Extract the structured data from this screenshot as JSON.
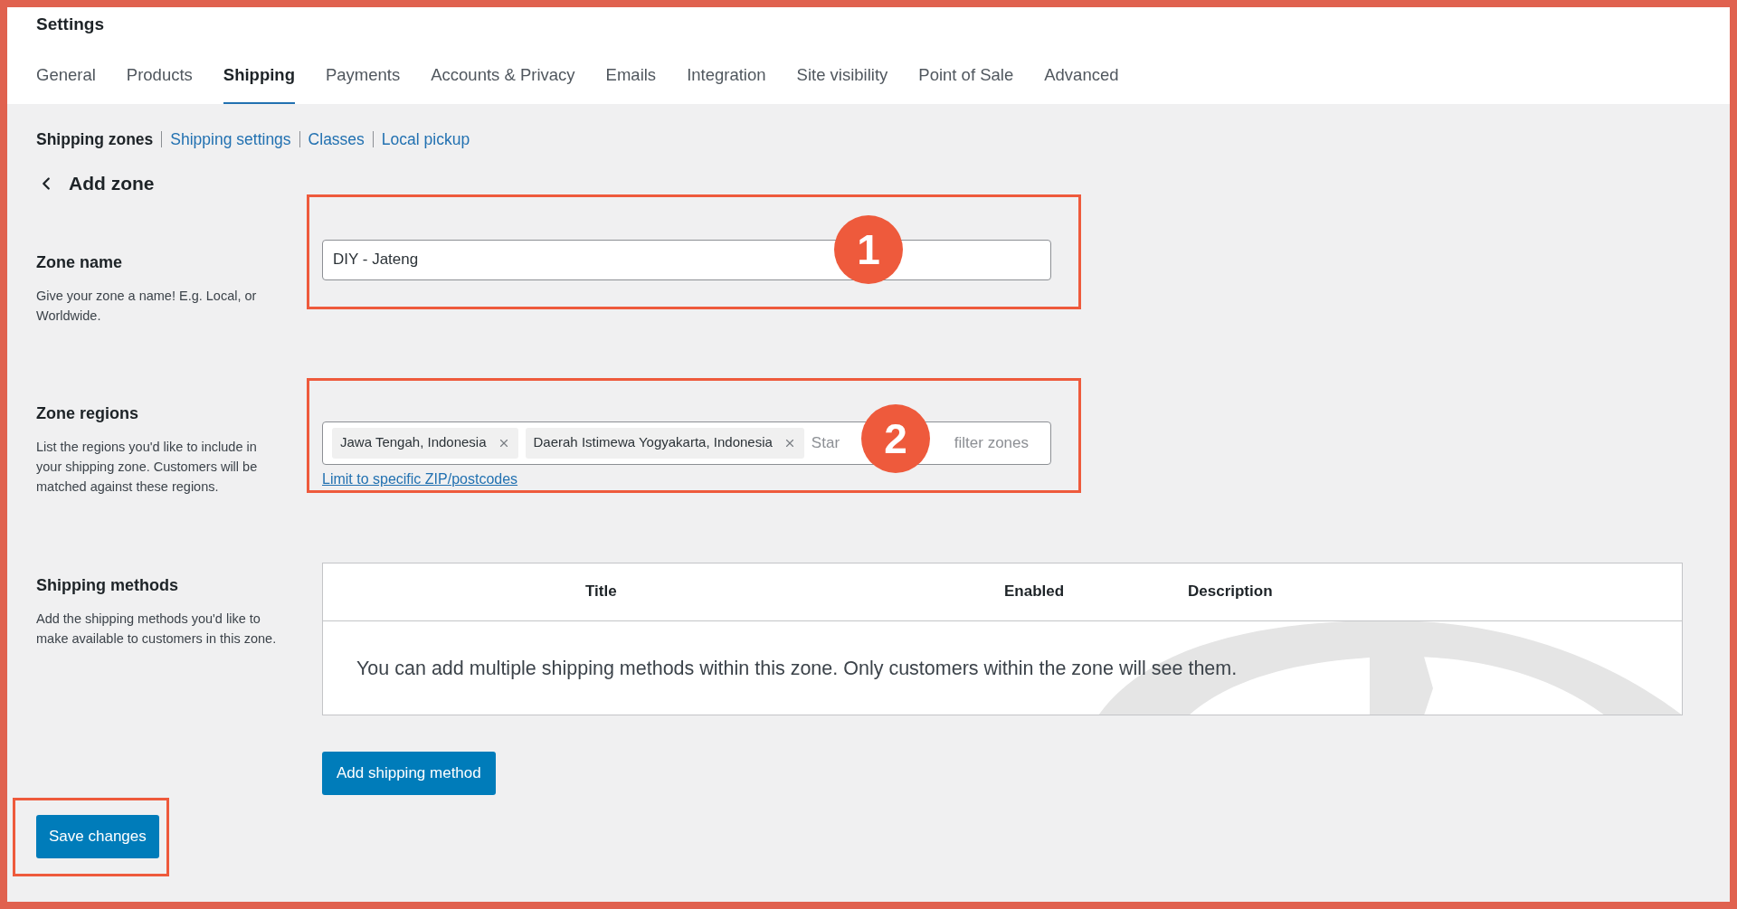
{
  "header": {
    "title": "Settings"
  },
  "tabs": [
    {
      "label": "General",
      "selected": false
    },
    {
      "label": "Products",
      "selected": false
    },
    {
      "label": "Shipping",
      "selected": true
    },
    {
      "label": "Payments",
      "selected": false
    },
    {
      "label": "Accounts & Privacy",
      "selected": false
    },
    {
      "label": "Emails",
      "selected": false
    },
    {
      "label": "Integration",
      "selected": false
    },
    {
      "label": "Site visibility",
      "selected": false
    },
    {
      "label": "Point of Sale",
      "selected": false
    },
    {
      "label": "Advanced",
      "selected": false
    }
  ],
  "subnav": [
    {
      "label": "Shipping zones",
      "selected": true
    },
    {
      "label": "Shipping settings",
      "selected": false
    },
    {
      "label": "Classes",
      "selected": false
    },
    {
      "label": "Local pickup",
      "selected": false
    }
  ],
  "page_title": "Add zone",
  "zone_name": {
    "label": "Zone name",
    "help": "Give your zone a name! E.g. Local, or Worldwide.",
    "value": "DIY - Jateng"
  },
  "zone_regions": {
    "label": "Zone regions",
    "help": "List the regions you'd like to include in your shipping zone. Customers will be matched against these regions.",
    "chips": [
      "Jawa Tengah, Indonesia",
      "Daerah Istimewa Yogyakarta, Indonesia"
    ],
    "placeholder_parts": [
      "Star",
      "filter zones"
    ],
    "link": "Limit to specific ZIP/postcodes"
  },
  "shipping_methods": {
    "label": "Shipping methods",
    "help": "Add the shipping methods you'd like to make available to customers in this zone.",
    "columns": [
      "Title",
      "Enabled",
      "Description"
    ],
    "empty_message": "You can add multiple shipping methods within this zone. Only customers within the zone will see them.",
    "add_button": "Add shipping method"
  },
  "save_button": "Save changes",
  "callouts": [
    {
      "number": "1"
    },
    {
      "number": "2"
    }
  ]
}
